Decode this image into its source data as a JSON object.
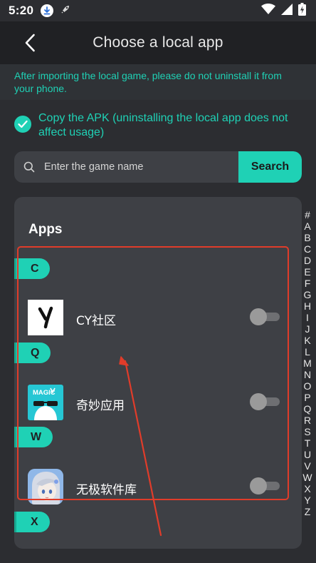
{
  "status_bar": {
    "time": "5:20"
  },
  "header": {
    "title": "Choose a local app"
  },
  "notice": {
    "text": "After importing the local game, please do not uninstall it from your phone."
  },
  "copy_option": {
    "label": "Copy the APK (uninstalling the local app does not affect usage)",
    "checked": true
  },
  "search": {
    "placeholder": "Enter the game name",
    "value": "",
    "button_label": "Search"
  },
  "apps_section": {
    "heading": "Apps",
    "groups": [
      {
        "letter": "C",
        "app": {
          "name": "CY社区",
          "icon": "cy-logo-icon",
          "enabled": false
        }
      },
      {
        "letter": "Q",
        "app": {
          "name": "奇妙应用",
          "icon": "magic-app-icon",
          "icon_text": "MAGIC",
          "enabled": false
        }
      },
      {
        "letter": "W",
        "app": {
          "name": "无极软件库",
          "icon": "anime-avatar-icon",
          "enabled": false
        }
      },
      {
        "letter": "X"
      }
    ]
  },
  "alphabet_index": [
    "#",
    "A",
    "B",
    "C",
    "D",
    "E",
    "F",
    "G",
    "H",
    "I",
    "J",
    "K",
    "L",
    "M",
    "N",
    "O",
    "P",
    "Q",
    "R",
    "S",
    "T",
    "U",
    "V",
    "W",
    "X",
    "Y",
    "Z"
  ],
  "colors": {
    "accent": "#1fd1b5",
    "background": "#2c2d31",
    "header": "#202124",
    "card": "#3e4045",
    "annotation": "#e03c2a"
  }
}
